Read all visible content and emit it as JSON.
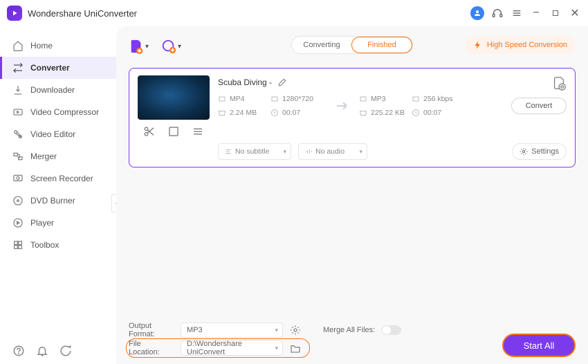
{
  "app": {
    "title": "Wondershare UniConverter"
  },
  "titlebar": {
    "min": "−",
    "max": "▢",
    "close": "✕"
  },
  "sidebar": {
    "items": [
      {
        "label": "Home"
      },
      {
        "label": "Converter"
      },
      {
        "label": "Downloader"
      },
      {
        "label": "Video Compressor"
      },
      {
        "label": "Video Editor"
      },
      {
        "label": "Merger"
      },
      {
        "label": "Screen Recorder"
      },
      {
        "label": "DVD Burner"
      },
      {
        "label": "Player"
      },
      {
        "label": "Toolbox"
      }
    ]
  },
  "tabs": {
    "converting": "Converting",
    "finished": "Finished"
  },
  "hispeed": "High Speed Conversion",
  "file": {
    "title": "Scuba Diving -",
    "src": {
      "format": "MP4",
      "resolution": "1280*720",
      "size": "2.24 MB",
      "duration": "00:07"
    },
    "dst": {
      "format": "MP3",
      "bitrate": "256 kbps",
      "size": "225.22 KB",
      "duration": "00:07"
    },
    "subtitle": "No subtitle",
    "audio": "No audio",
    "settings": "Settings",
    "convert": "Convert"
  },
  "bottom": {
    "output_format_label": "Output Format:",
    "output_format": "MP3",
    "file_location_label": "File Location:",
    "file_location": "D:\\Wondershare UniConvert",
    "merge_label": "Merge All Files:",
    "start_all": "Start All"
  }
}
